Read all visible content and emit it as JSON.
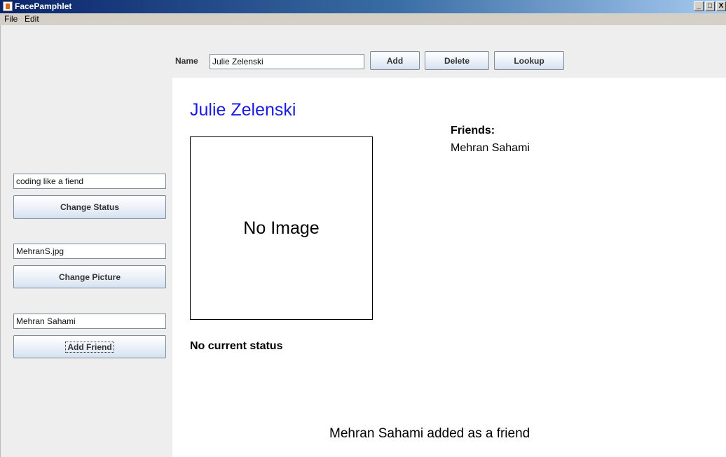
{
  "window": {
    "title": "FacePamphlet",
    "controls": {
      "minimize": "_",
      "maximize": "□",
      "close": "X"
    }
  },
  "menu": {
    "items": [
      "File",
      "Edit"
    ]
  },
  "north": {
    "name_label": "Name",
    "name_value": "Julie Zelenski",
    "add_label": "Add",
    "delete_label": "Delete",
    "lookup_label": "Lookup"
  },
  "west": {
    "status_value": "coding like a fiend",
    "change_status_label": "Change Status",
    "picture_value": "MehranS.jpg",
    "change_picture_label": "Change Picture",
    "friend_value": "Mehran Sahami",
    "add_friend_label": "Add Friend"
  },
  "profile": {
    "name": "Julie Zelenski",
    "image_placeholder": "No Image",
    "status": "No current status",
    "friends_header": "Friends:",
    "friends": [
      "Mehran Sahami"
    ]
  },
  "message": "Mehran Sahami added as a friend",
  "colors": {
    "profile_name": "#1a1ae6",
    "canvas_bg": "#ffffff",
    "panel_bg": "#eeeeee"
  }
}
